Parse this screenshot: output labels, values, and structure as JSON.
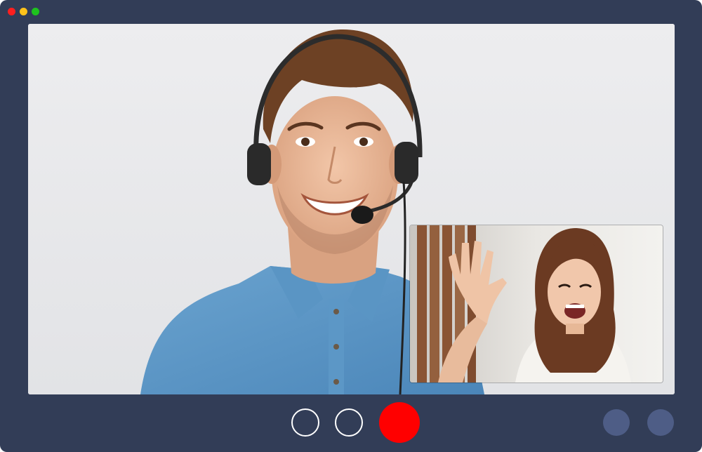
{
  "window": {
    "title_dots": [
      "close",
      "minimize",
      "maximize"
    ]
  },
  "main_video": {
    "icon": "main-participant-video",
    "description": ""
  },
  "pip_video": {
    "icon": "self-view-video"
  },
  "controls": {
    "mic_icon": "microphone-toggle",
    "camera_icon": "camera-toggle",
    "end_call_icon": "end-call",
    "side_buttons": [
      "options",
      "more"
    ]
  },
  "colors": {
    "window_bg": "#323d57",
    "end_call": "#ff0000",
    "side_button": "#4e5d86",
    "dot_close": "#ff1f1f",
    "dot_min": "#ffc21a",
    "dot_max": "#1ec31e"
  }
}
